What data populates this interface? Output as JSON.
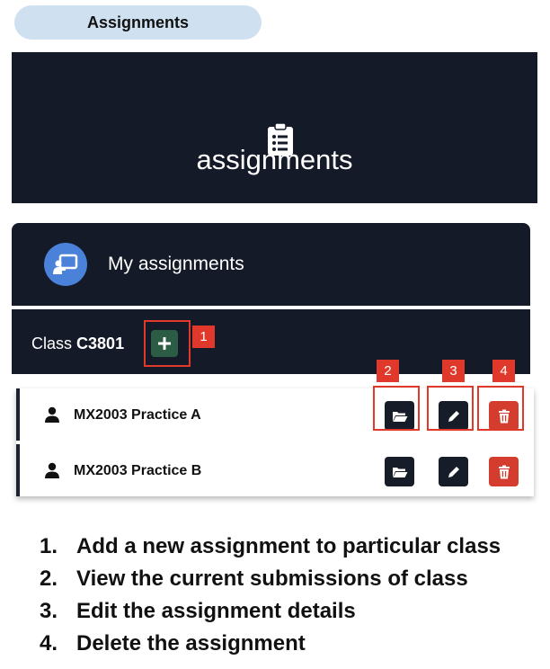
{
  "header": {
    "title": "Assignments"
  },
  "hero": {
    "icon": "clipboard-list-icon",
    "title": "assignments"
  },
  "panel": {
    "icon": "teacher-board-icon",
    "title": "My assignments"
  },
  "class_bar": {
    "prefix": "Class",
    "code": "C3801",
    "add_icon": "plus-icon"
  },
  "callouts": [
    "1",
    "2",
    "3",
    "4"
  ],
  "assignments": [
    {
      "icon": "user-icon",
      "name": "MX2003 Practice A"
    },
    {
      "icon": "user-icon",
      "name": "MX2003 Practice B"
    }
  ],
  "actions": {
    "view_icon": "folder-open-icon",
    "edit_icon": "pencil-icon",
    "delete_icon": "trash-icon"
  },
  "legend": [
    {
      "num": "1.",
      "text": "Add a new assignment to particular class"
    },
    {
      "num": "2.",
      "text": "View the current submissions of class"
    },
    {
      "num": "3.",
      "text": "Edit the assignment details"
    },
    {
      "num": "4.",
      "text": "Delete the assignment"
    }
  ],
  "colors": {
    "panel_bg": "#141a27",
    "accent_blue": "#4a82d9",
    "add_green": "#2c5c43",
    "delete_red": "#d43c2e",
    "callout_red": "#e0392b",
    "pill_bg": "#cfe0f0"
  }
}
